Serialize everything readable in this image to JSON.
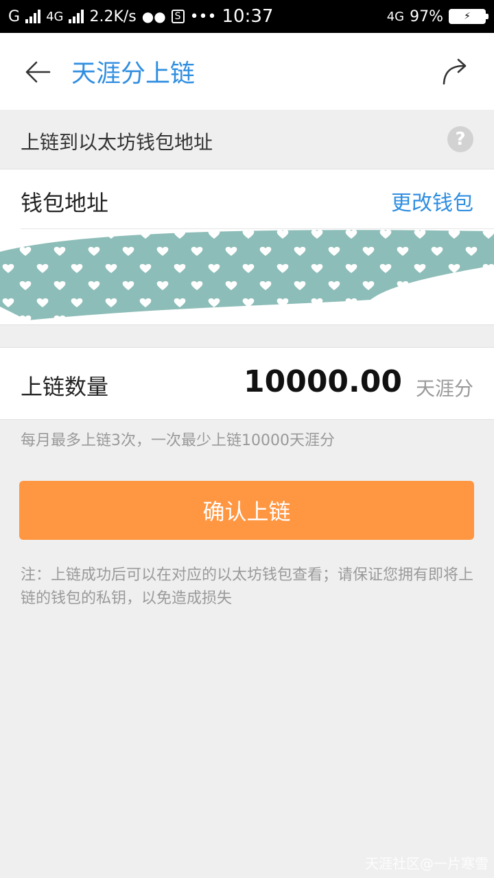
{
  "status_bar": {
    "carrier": "G",
    "network": "4G",
    "speed": "2.2K/s",
    "sim_badge": "S",
    "dots": "•••",
    "time": "10:37",
    "network2": "4G",
    "battery_percent": "97%"
  },
  "nav": {
    "title": "天涯分上链"
  },
  "section": {
    "label": "上链到以太坊钱包地址",
    "help_glyph": "?"
  },
  "wallet": {
    "label": "钱包地址",
    "change_link": "更改钱包"
  },
  "amount": {
    "label": "上链数量",
    "value": "10000.00",
    "unit": "天涯分"
  },
  "hint": "每月最多上链3次，一次最少上链10000天涯分",
  "confirm_button": "确认上链",
  "note": "注：上链成功后可以在对应的以太坊钱包查看；请保证您拥有即将上链的钱包的私钥，以免造成损失",
  "watermark": "天涯社区@一片寒雪",
  "colors": {
    "accent_blue": "#2f8ee0",
    "button_orange": "#ff9642",
    "redaction": "#8dbdb8"
  },
  "icons": {
    "back": "arrow-left-icon",
    "share": "share-arrow-icon",
    "help": "question-icon"
  }
}
